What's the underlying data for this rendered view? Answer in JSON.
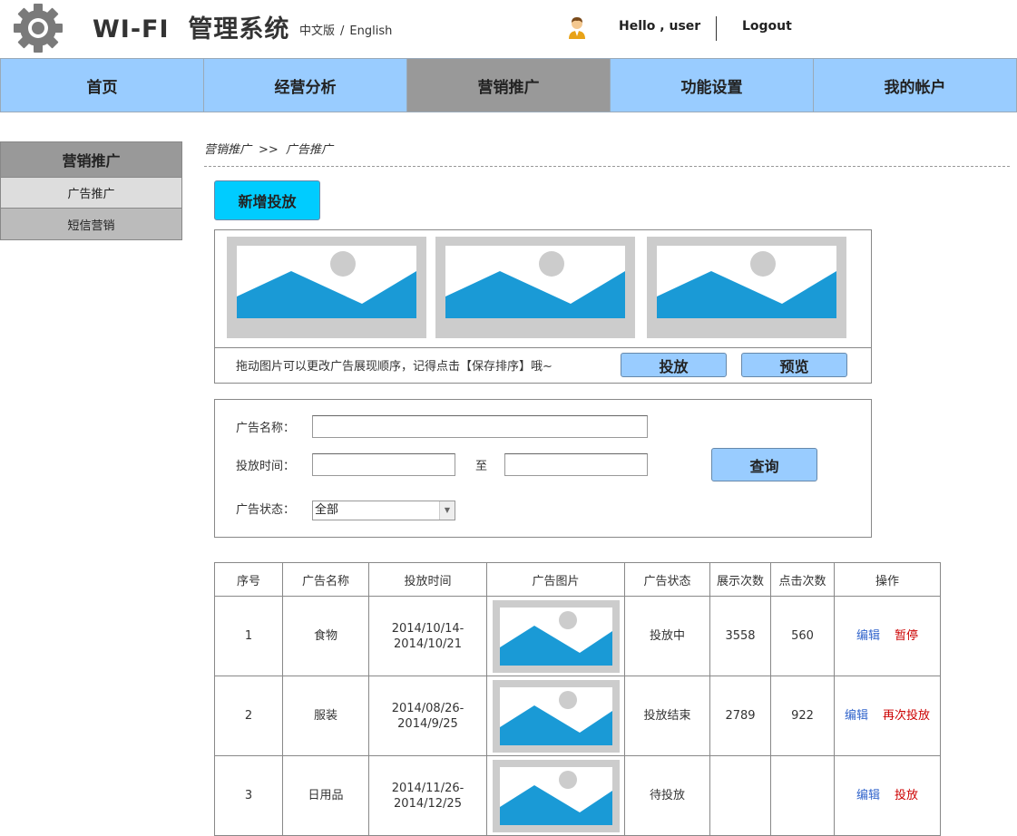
{
  "header": {
    "title": "WI-FI  管理系统",
    "lang_cn": "中文版",
    "lang_sep": "/",
    "lang_en": "English",
    "greeting": "Hello , user",
    "logout": "Logout"
  },
  "nav": {
    "items": [
      {
        "label": "首页",
        "active": false
      },
      {
        "label": "经营分析",
        "active": false
      },
      {
        "label": "营销推广",
        "active": true
      },
      {
        "label": "功能设置",
        "active": false
      },
      {
        "label": "我的帐户",
        "active": false
      }
    ]
  },
  "sidebar": {
    "title": "营销推广",
    "items": [
      {
        "label": "广告推广",
        "active": true
      },
      {
        "label": "短信营销",
        "active": false
      }
    ]
  },
  "breadcrumb": {
    "parent": "营销推广",
    "sep": ">>",
    "current": "广告推广"
  },
  "actions": {
    "add_label": "新增投放"
  },
  "image_panel": {
    "hint": "拖动图片可以更改广告展现顺序，记得点击【保存排序】哦~",
    "publish_label": "投放",
    "preview_label": "预览",
    "image_count": 3
  },
  "search": {
    "name_label": "广告名称：",
    "name_value": "",
    "time_label": "投放时间：",
    "time_from": "",
    "time_to_label": "至",
    "time_to": "",
    "status_label": "广告状态：",
    "status_value": "全部",
    "query_label": "查询"
  },
  "table": {
    "headers": [
      "序号",
      "广告名称",
      "投放时间",
      "广告图片",
      "广告状态",
      "展示次数",
      "点击次数",
      "操作"
    ],
    "rows": [
      {
        "no": "1",
        "name": "食物",
        "time1": "2014/10/14-",
        "time2": "2014/10/21",
        "status": "投放中",
        "views": "3558",
        "clicks": "560",
        "edit": "编辑",
        "action": "暂停"
      },
      {
        "no": "2",
        "name": "服装",
        "time1": "2014/08/26-",
        "time2": "2014/9/25",
        "status": "投放结束",
        "views": "2789",
        "clicks": "922",
        "edit": "编辑",
        "action": "再次投放"
      },
      {
        "no": "3",
        "name": "日用品",
        "time1": "2014/11/26-",
        "time2": "2014/12/25",
        "status": "待投放",
        "views": "",
        "clicks": "",
        "edit": "编辑",
        "action": "投放"
      }
    ]
  },
  "colors": {
    "nav_bg": "#99ccff",
    "nav_active": "#999999",
    "add_button": "#00ccff",
    "image_blue": "#1a9ad6",
    "link_blue": "#3366cc",
    "link_red": "#cc0000"
  }
}
